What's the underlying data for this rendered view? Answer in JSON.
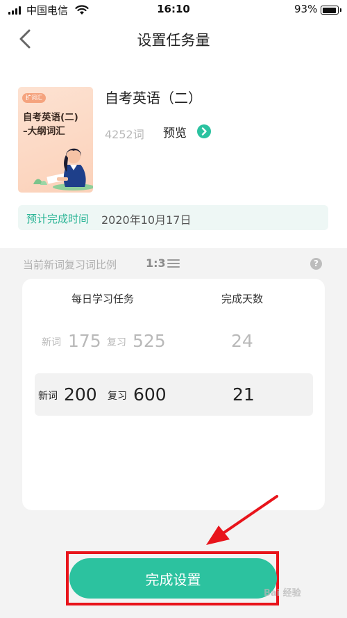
{
  "status_bar": {
    "carrier": "中国电信",
    "time": "16:10",
    "battery_pct": "93%",
    "battery_level": 0.93
  },
  "nav": {
    "title": "设置任务量",
    "back_icon": "chevron-left-icon"
  },
  "book": {
    "cover_badge": "扩词汇",
    "cover_title_line1": "自考英语(二)",
    "cover_title_line2": "–大纲词汇",
    "title": "自考英语（二）",
    "word_count": "4252词",
    "preview_label": "预览"
  },
  "eta": {
    "label": "预计完成时间",
    "value": "2020年10月17日"
  },
  "ratio": {
    "label": "当前新词复习词比例",
    "value": "1:3",
    "help": "?"
  },
  "plan": {
    "header_daily": "每日学习任务",
    "header_days": "完成天数",
    "rows": [
      {
        "new_label": "新词",
        "new_count": "175",
        "review_label": "复习",
        "review_count": "525",
        "days": "24",
        "selected": false
      },
      {
        "new_label": "新词",
        "new_count": "200",
        "review_label": "复习",
        "review_count": "600",
        "days": "21",
        "selected": true
      }
    ]
  },
  "actions": {
    "done_label": "完成设置"
  },
  "colors": {
    "accent": "#2cc29f",
    "annotation_red": "#e8141b"
  },
  "watermark": "Bai 经验"
}
